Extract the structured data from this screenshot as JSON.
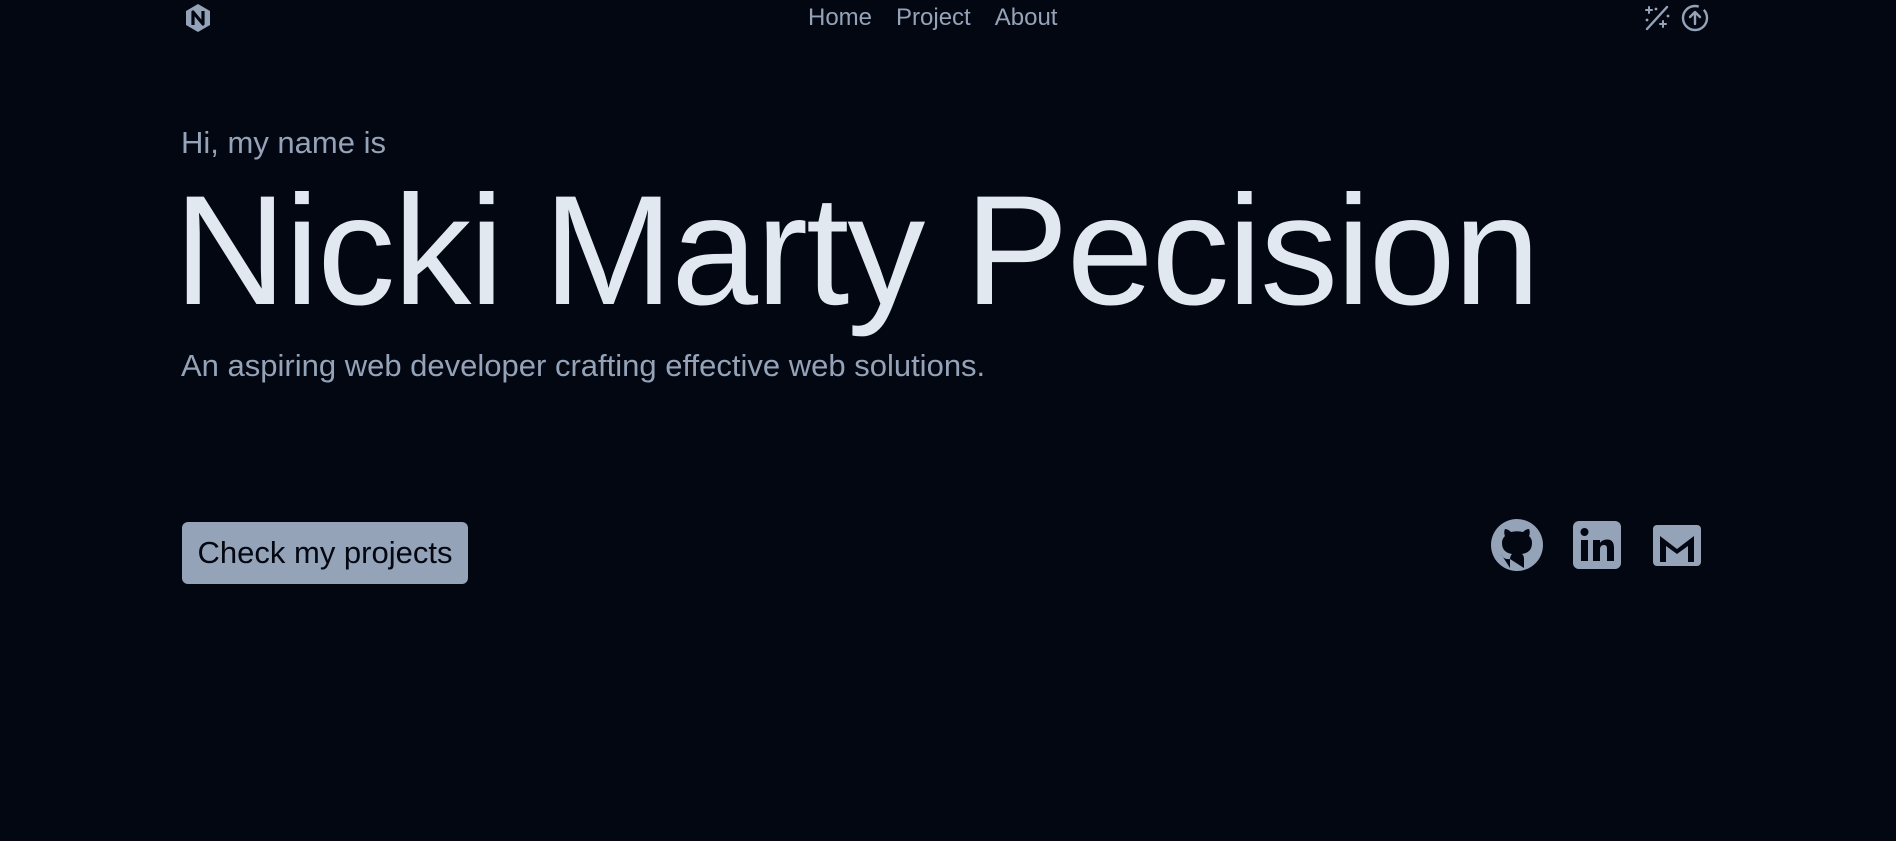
{
  "nav": {
    "links": [
      "Home",
      "Project",
      "About"
    ],
    "logo_icon": "nix-hexagon-logo-icon",
    "tools": [
      "magic-wand-icon",
      "upload-circle-icon"
    ]
  },
  "hero": {
    "greeting": "Hi, my name is",
    "name": "Nicki Marty Pecision",
    "tagline": "An aspiring web developer crafting effective web solutions.",
    "cta_label": "Check my projects"
  },
  "socials": [
    "github-icon",
    "linkedin-icon",
    "gmail-icon"
  ],
  "colors": {
    "background": "#030712",
    "text_muted": "#94a3b8",
    "text_bright": "#e2e8f0",
    "button_bg": "#94a3b8"
  }
}
